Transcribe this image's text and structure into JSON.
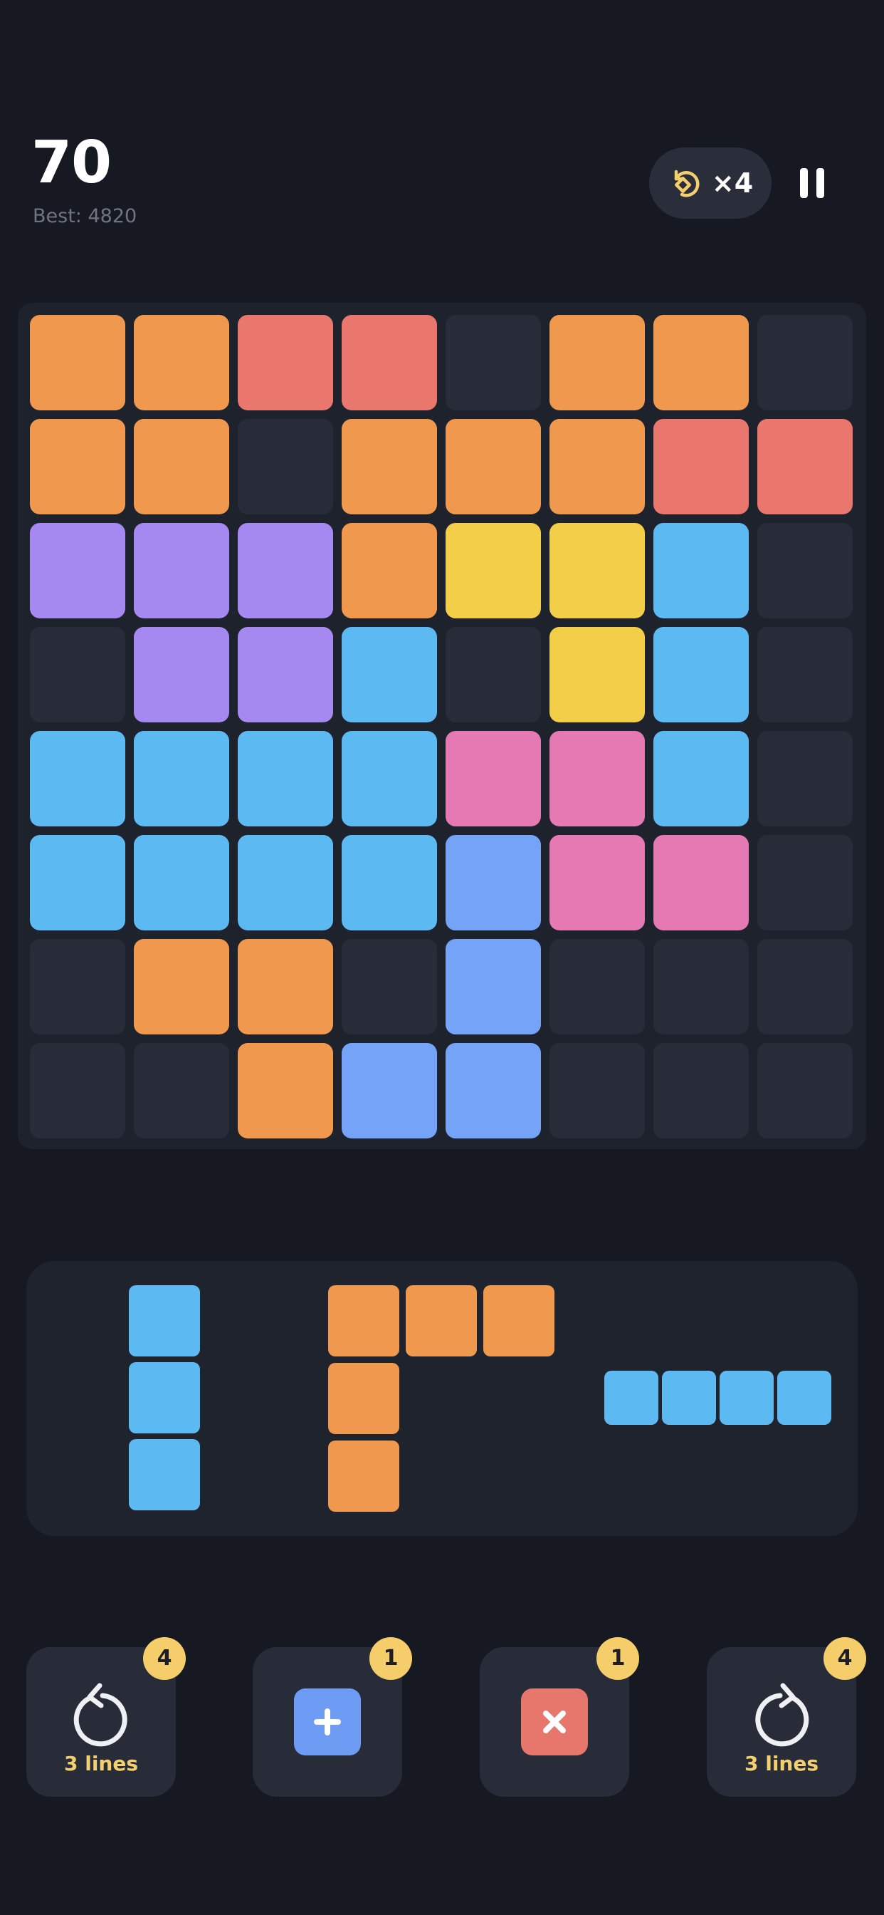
{
  "header": {
    "score": "70",
    "best": "Best: 4820",
    "rotate_count": "×4"
  },
  "board": {
    "size": 8,
    "palette": {
      "E": "#282c39",
      "O": "#ef984e",
      "R": "#e9776d",
      "P": "#a589f0",
      "Y": "#f3ce49",
      "C": "#5db9f1",
      "K": "#e579b3",
      "B": "#74a3f7"
    },
    "rows": [
      "OORRE OOE",
      "OOEOOORR",
      "PPPOYYCE",
      "EPPCEYCE",
      "CCCCKKCE",
      "CCCCBKKE",
      "EOOEBEEE",
      "EEOBBEEE"
    ]
  },
  "tray": {
    "pieces": [
      {
        "name": "vertical-three-block-piece",
        "color": "#5db9f1",
        "cells": [
          [
            0,
            0
          ],
          [
            1,
            0
          ],
          [
            2,
            0
          ]
        ]
      },
      {
        "name": "corner-l-block-piece",
        "color": "#ef984e",
        "cells": [
          [
            0,
            0
          ],
          [
            0,
            1
          ],
          [
            0,
            2
          ],
          [
            1,
            0
          ],
          [
            2,
            0
          ]
        ]
      },
      {
        "name": "horizontal-four-block-piece",
        "color": "#5db9f1",
        "cells": [
          [
            0,
            0
          ],
          [
            0,
            1
          ],
          [
            0,
            2
          ],
          [
            0,
            3
          ]
        ]
      }
    ]
  },
  "powerups": [
    {
      "id": "undo",
      "label": "3 lines",
      "badge": "4"
    },
    {
      "id": "add",
      "label": "",
      "badge": "1",
      "color": "#6e9cf5"
    },
    {
      "id": "remove",
      "label": "",
      "badge": "1",
      "color": "#e7766c"
    },
    {
      "id": "redo",
      "label": "3 lines",
      "badge": "4"
    }
  ]
}
